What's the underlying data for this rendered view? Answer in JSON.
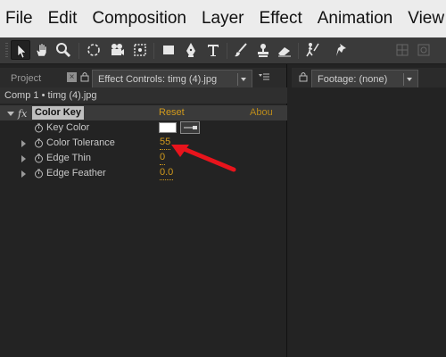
{
  "menubar": {
    "items": [
      "File",
      "Edit",
      "Composition",
      "Layer",
      "Effect",
      "Animation",
      "View"
    ]
  },
  "toolbar": {
    "tools": [
      "selection-tool-icon",
      "hand-tool-icon",
      "zoom-tool-icon",
      "rotation-tool-icon",
      "unified-camera-tool-icon",
      "pan-behind-tool-icon",
      "rectangle-tool-icon",
      "pen-tool-icon",
      "type-tool-icon",
      "brush-tool-icon",
      "clone-stamp-tool-icon",
      "eraser-tool-icon",
      "roto-brush-tool-icon",
      "puppet-pin-tool-icon"
    ],
    "active_tool": "selection-tool-icon"
  },
  "left_panel": {
    "tabs": {
      "project": "Project",
      "effect_controls": "Effect Controls: timg (4).jpg"
    },
    "comp_layer": "Comp 1 • timg (4).jpg",
    "effect": {
      "fx_symbol": "fx",
      "name": "Color Key",
      "reset": "Reset",
      "about": "Abou",
      "properties": {
        "key_color": {
          "label": "Key Color",
          "color": "#ffffff"
        },
        "color_tolerance": {
          "label": "Color Tolerance",
          "value": "55"
        },
        "edge_thin": {
          "label": "Edge Thin",
          "value": "0"
        },
        "edge_feather": {
          "label": "Edge Feather",
          "value": "0.0"
        }
      }
    }
  },
  "right_panel": {
    "tab": "Footage: (none)"
  },
  "colors": {
    "accent_value": "#d19a1d",
    "panel_bg": "#232323",
    "annotation_arrow": "#e8141c"
  }
}
